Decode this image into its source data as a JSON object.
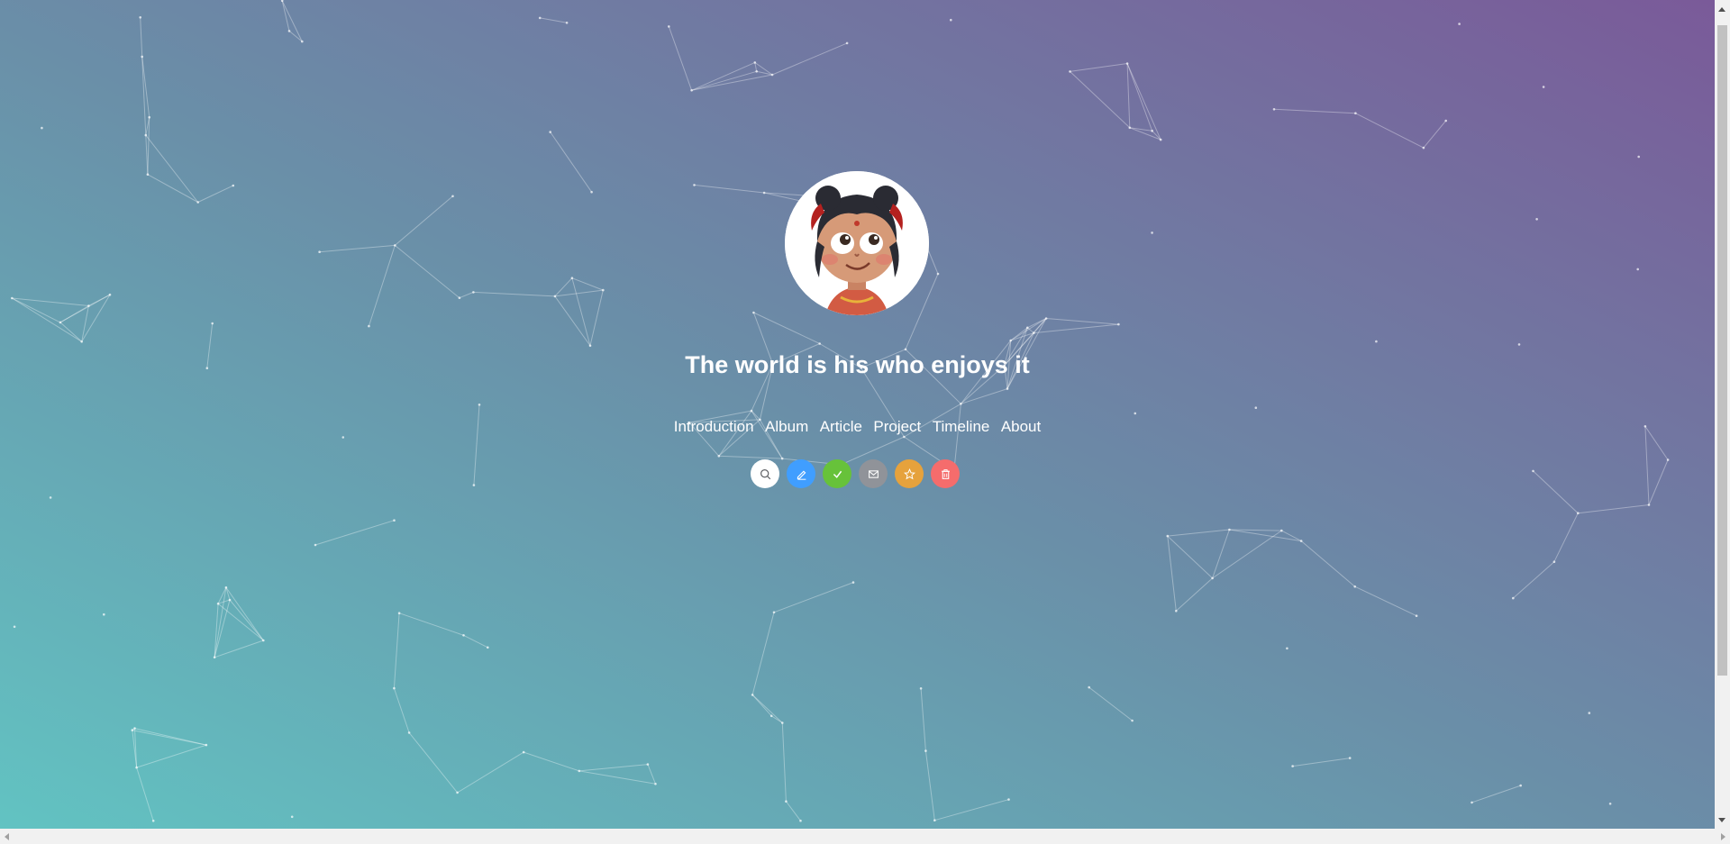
{
  "hero": {
    "title": "The world is his who enjoys it"
  },
  "nav": {
    "items": [
      "Introduction",
      "Album",
      "Article",
      "Project",
      "Timeline",
      "About"
    ]
  },
  "actions": [
    {
      "icon": "search-icon",
      "color": "#ffffff"
    },
    {
      "icon": "edit-icon",
      "color": "#409eff"
    },
    {
      "icon": "check-icon",
      "color": "#67c23a"
    },
    {
      "icon": "message-icon",
      "color": "#909399"
    },
    {
      "icon": "star-icon",
      "color": "#e6a23c"
    },
    {
      "icon": "delete-icon",
      "color": "#f56c6c"
    }
  ],
  "colors": {
    "gradient_start": "#62c3c2",
    "gradient_mid": "#6a8fa8",
    "gradient_end": "#7a5a99"
  }
}
